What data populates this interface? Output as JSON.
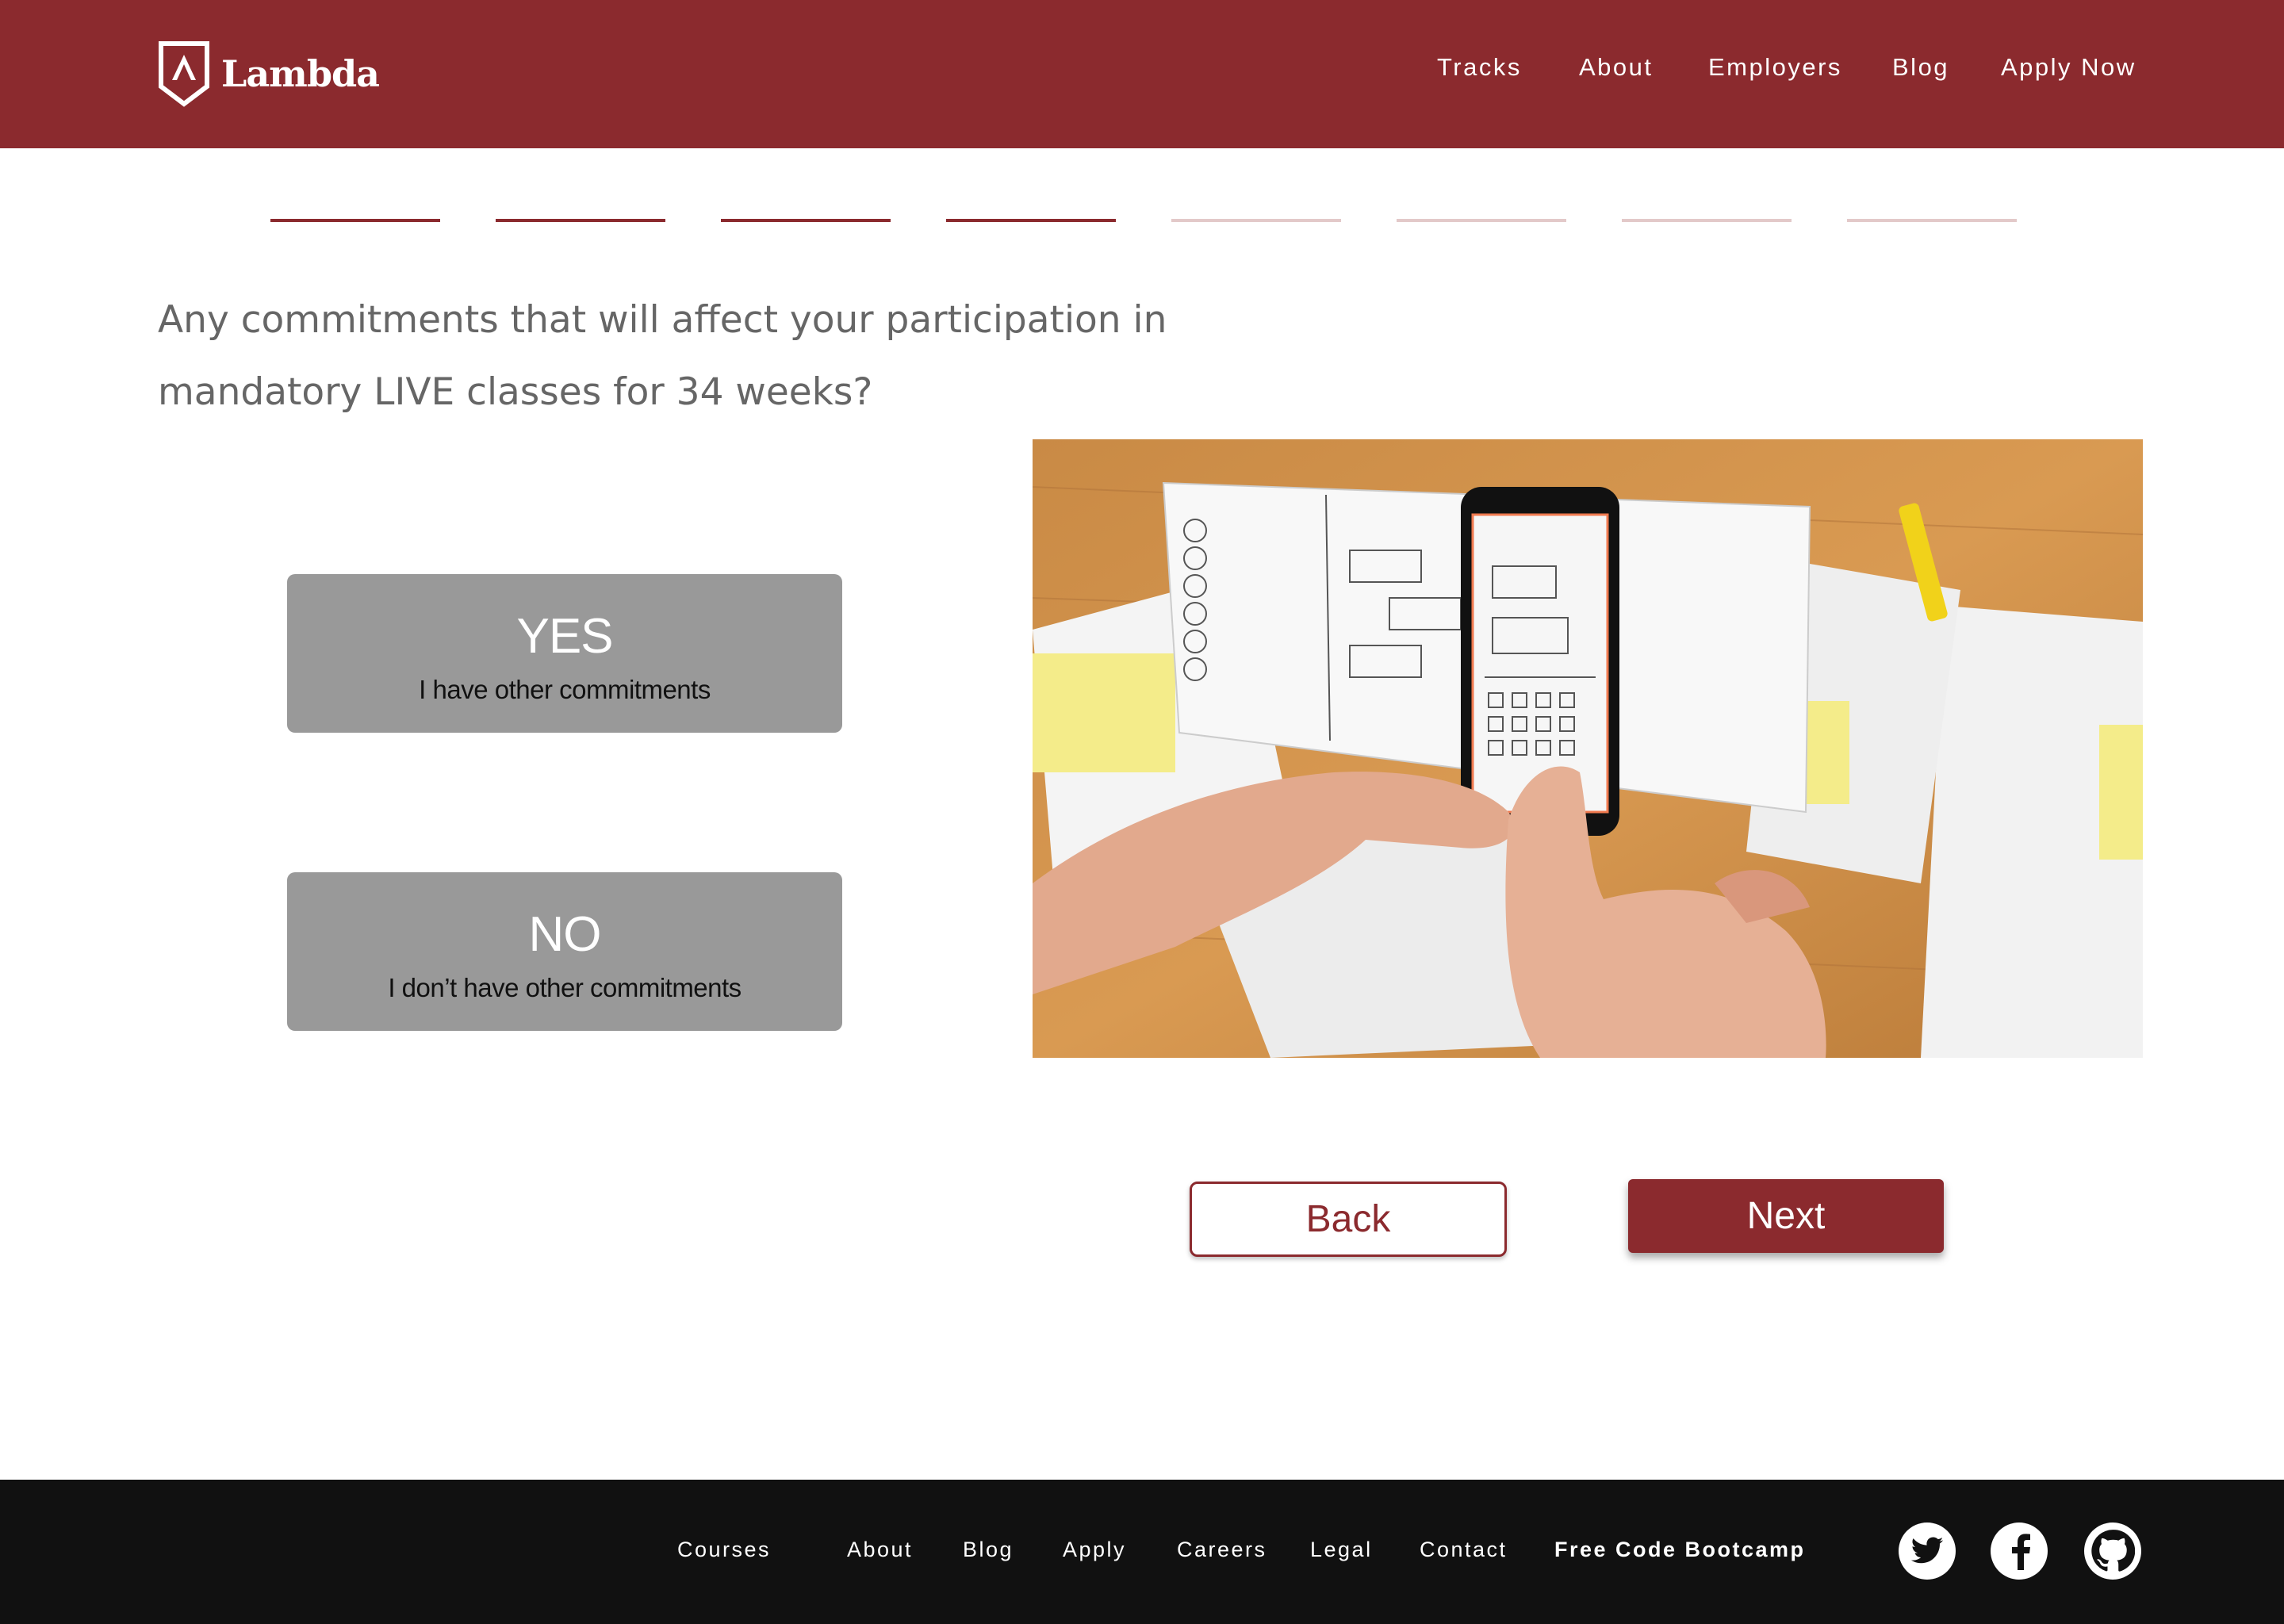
{
  "brand": {
    "name": "Lambda",
    "color": "#8b2a2e"
  },
  "nav": {
    "items": [
      "Tracks",
      "About",
      "Employers",
      "Blog",
      "Apply Now"
    ]
  },
  "progress": {
    "total_steps": 8,
    "completed_steps": 4
  },
  "question": {
    "text": "Any commitments that will affect your participation in mandatory LIVE classes for 34 weeks?"
  },
  "options": [
    {
      "label": "YES",
      "sublabel": "I have other commitments"
    },
    {
      "label": "NO",
      "sublabel": "I don’t have other commitments"
    }
  ],
  "buttons": {
    "back": "Back",
    "next": "Next"
  },
  "footer": {
    "links": [
      "Courses",
      "About",
      "Blog",
      "Apply",
      "Careers",
      "Legal",
      "Contact",
      "Free Code Bootcamp"
    ],
    "social": [
      "twitter-icon",
      "facebook-icon",
      "github-icon"
    ]
  }
}
